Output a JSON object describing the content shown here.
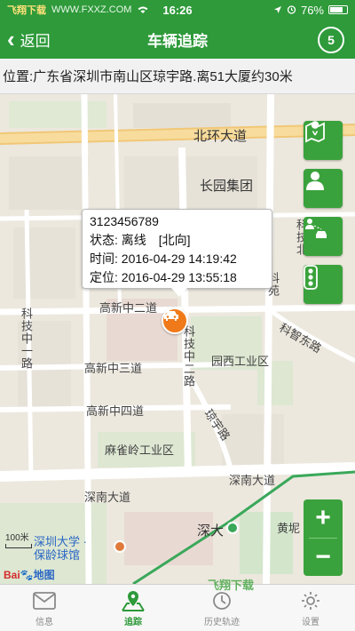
{
  "status_bar": {
    "carrier": "飞翔下载",
    "website": "WWW.FXXZ.COM",
    "time": "16:26",
    "battery": "76%"
  },
  "header": {
    "back_label": "返回",
    "title": "车辆追踪",
    "refresh_countdown": "5"
  },
  "location": {
    "text": "位置:广东省深圳市南山区琼宇路.离51大厦约30米"
  },
  "map": {
    "roads": {
      "beihuan": "北环大道",
      "gaoxin_zhong2": "高新中二道",
      "gaoxin_zhong3": "高新中三道",
      "gaoxin_zhong4": "高新中四道",
      "shennan": "深南大道",
      "shennan_short": "深南大道",
      "keji_zhong1": "科技中一路",
      "keji_zhong2": "科技中二路",
      "keyuan": "科苑",
      "keji_dong": "科智东路",
      "qiongyu": "琼宇路",
      "keji_north": "科技北"
    },
    "pois": {
      "changyuan": "长园集团",
      "yuanxi": "园西工业区",
      "maqueling": "麻雀岭工业区",
      "shenda": "深大",
      "szu_bowling": "深圳大学 · 保龄球馆",
      "huangni": "黄坭"
    },
    "scale_label": "100米",
    "logo_bai": "Bai",
    "logo_du": "地图"
  },
  "popup": {
    "plate": "3123456789",
    "status_label": "状态:",
    "status_value": "离线",
    "direction": "[北向]",
    "time_label": "时间:",
    "time_value": "2016-04-29 14:19:42",
    "locate_label": "定位:",
    "locate_value": "2016-04-29 13:55:18"
  },
  "side_buttons": [
    "map-locate-icon",
    "person-icon",
    "person-car-icon",
    "traffic-light-icon"
  ],
  "zoom": {
    "in": "+",
    "out": "−"
  },
  "tabs": [
    {
      "label": "信息",
      "icon": "envelope-icon",
      "active": false
    },
    {
      "label": "追踪",
      "icon": "map-pin-icon",
      "active": true
    },
    {
      "label": "历史轨迹",
      "icon": "history-track-icon",
      "active": false
    },
    {
      "label": "设置",
      "icon": "settings-icon",
      "active": false
    }
  ],
  "watermark": "飞翔下载",
  "colors": {
    "primary_green": "#2e9a3a",
    "button_green": "#3aa23c",
    "marker_orange": "#f07a1a"
  }
}
